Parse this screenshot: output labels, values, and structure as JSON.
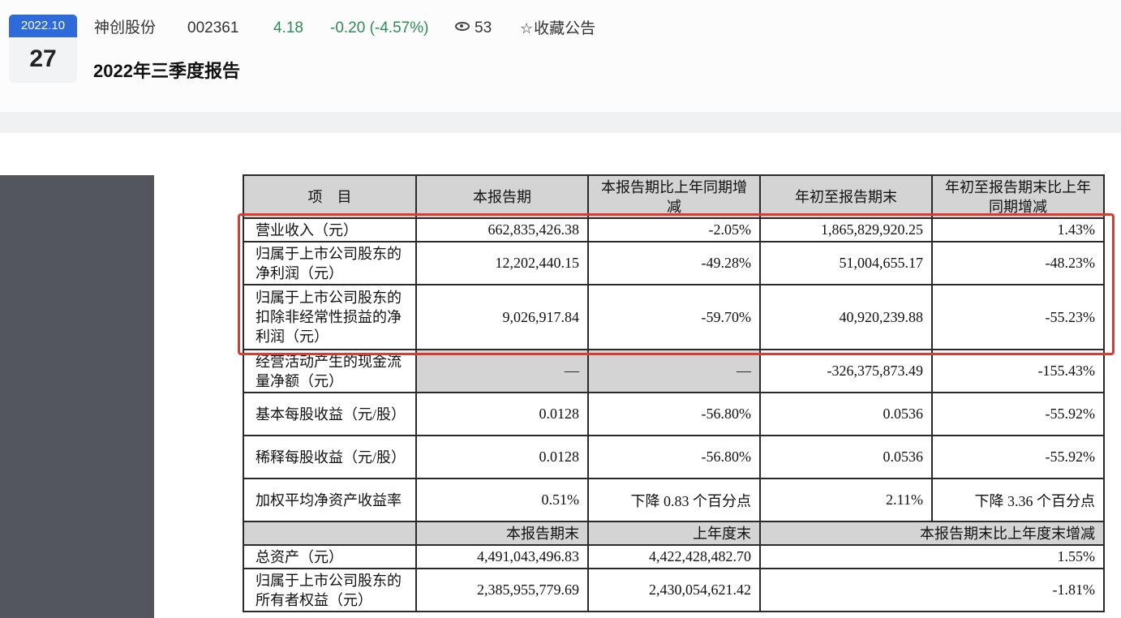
{
  "header": {
    "date_month": "2022.10",
    "date_day": "27",
    "stock_name": "神创股份",
    "stock_code": "002361",
    "price": "4.18",
    "change": "-0.20 (-4.57%)",
    "views": "53",
    "favorite_label": "收藏公告",
    "title": "2022年三季度报告",
    "up_color": "#2e8b57",
    "date_color": "#2f6bd8"
  },
  "table": {
    "headers": [
      "项　目",
      "本报告期",
      "本报告期比上年同期增减",
      "年初至报告期末",
      "年初至报告期末比上年同期增减"
    ],
    "rows": [
      {
        "label": "营业收入（元）",
        "v1": "662,835,426.38",
        "v2": "-2.05%",
        "v3": "1,865,829,920.25",
        "v4": "1.43%"
      },
      {
        "label": "归属于上市公司股东的净利润（元）",
        "v1": "12,202,440.15",
        "v2": "-49.28%",
        "v3": "51,004,655.17",
        "v4": "-48.23%"
      },
      {
        "label": "归属于上市公司股东的扣除非经常性损益的净利润（元）",
        "v1": "9,026,917.84",
        "v2": "-59.70%",
        "v3": "40,920,239.88",
        "v4": "-55.23%"
      },
      {
        "label": "经营活动产生的现金流量净额（元）",
        "v1": "—",
        "v2": "—",
        "v3": "-326,375,873.49",
        "v4": "-155.43%"
      },
      {
        "label": "基本每股收益（元/股）",
        "v1": "0.0128",
        "v2": "-56.80%",
        "v3": "0.0536",
        "v4": "-55.92%"
      },
      {
        "label": "稀释每股收益（元/股）",
        "v1": "0.0128",
        "v2": "-56.80%",
        "v3": "0.0536",
        "v4": "-55.92%"
      },
      {
        "label": "加权平均净资产收益率",
        "v1": "0.51%",
        "v2": "下降 0.83 个百分点",
        "v3": "2.11%",
        "v4": "下降 3.36 个百分点"
      }
    ],
    "sub_headers": [
      "本报告期末",
      "上年度末",
      "本报告期末比上年度末增减"
    ],
    "sub_rows": [
      {
        "label": "总资产（元）",
        "v1": "4,491,043,496.83",
        "v2": "4,422,428,482.70",
        "v3": "1.55%"
      },
      {
        "label": "归属于上市公司股东的所有者权益（元）",
        "v1": "2,385,955,779.69",
        "v2": "2,430,054,621.42",
        "v3": "-1.81%"
      }
    ]
  },
  "highlight_color": "#e03a30"
}
